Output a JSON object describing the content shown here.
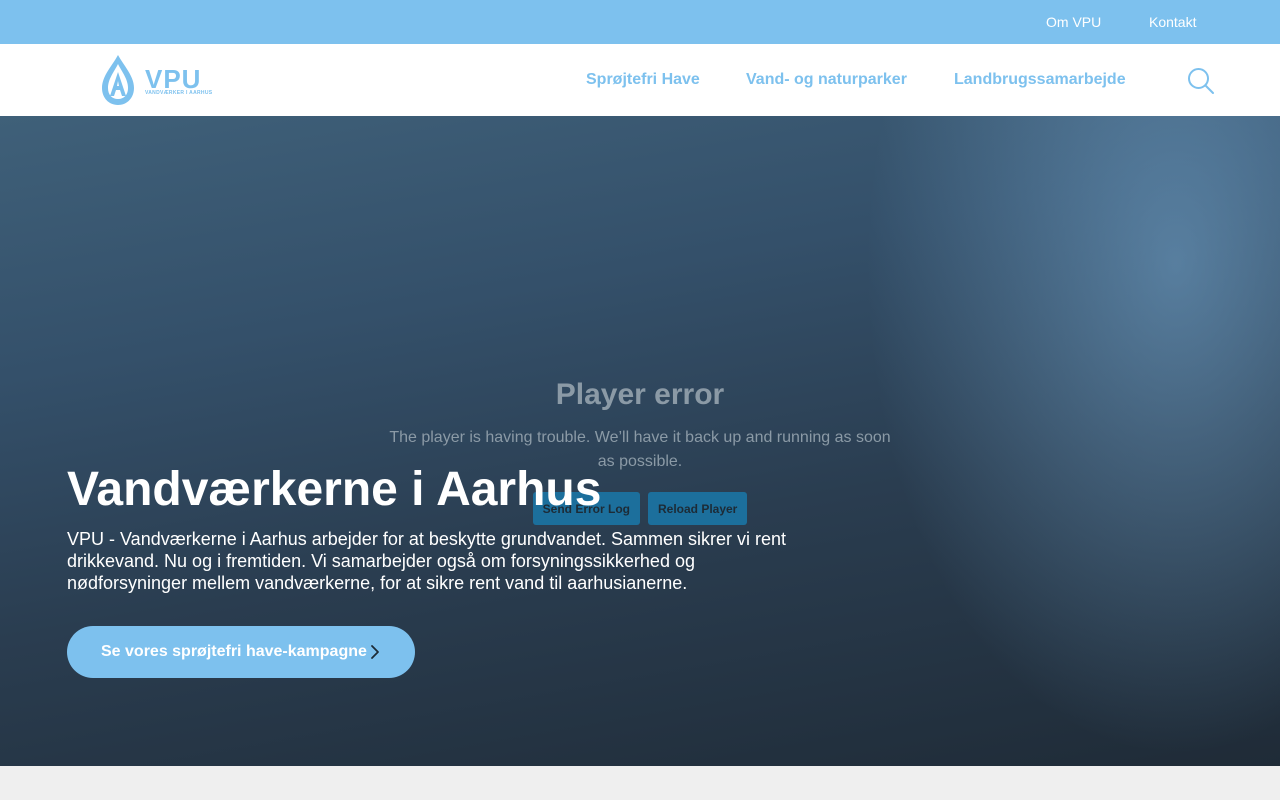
{
  "topbar": {
    "links": [
      {
        "label": "Om VPU"
      },
      {
        "label": "Kontakt"
      }
    ]
  },
  "header": {
    "logo": {
      "text": "VPU",
      "tagline": "VANDVÆRKER I AARHUS"
    },
    "nav": [
      {
        "label": "Sprøjtefri Have"
      },
      {
        "label": "Vand- og naturparker"
      },
      {
        "label": "Landbrugssamarbejde"
      }
    ],
    "search_icon": "search-icon"
  },
  "player_error": {
    "title": "Player error",
    "message": "The player is having trouble. We’ll have it back up and running as soon as possible.",
    "buttons": [
      {
        "label": "Send Error Log"
      },
      {
        "label": "Reload Player"
      }
    ]
  },
  "hero": {
    "title": "Vandværkerne i Aarhus",
    "intro": "VPU - Vandværkerne i Aarhus arbejder for at beskytte grundvandet. Sammen sikrer vi rent drikkevand. Nu og i fremtiden. Vi samarbejder også om forsyningssikkerhed og nødforsyninger mellem vandværkerne, for at sikre rent vand til aarhusianerne.",
    "cta": {
      "label": "Se vores sprøjtefri have-kampagne",
      "icon": "chevron-right-icon"
    }
  },
  "colors": {
    "accent": "#7dc1ee",
    "white": "#ffffff",
    "footer_bg": "#efefef"
  }
}
